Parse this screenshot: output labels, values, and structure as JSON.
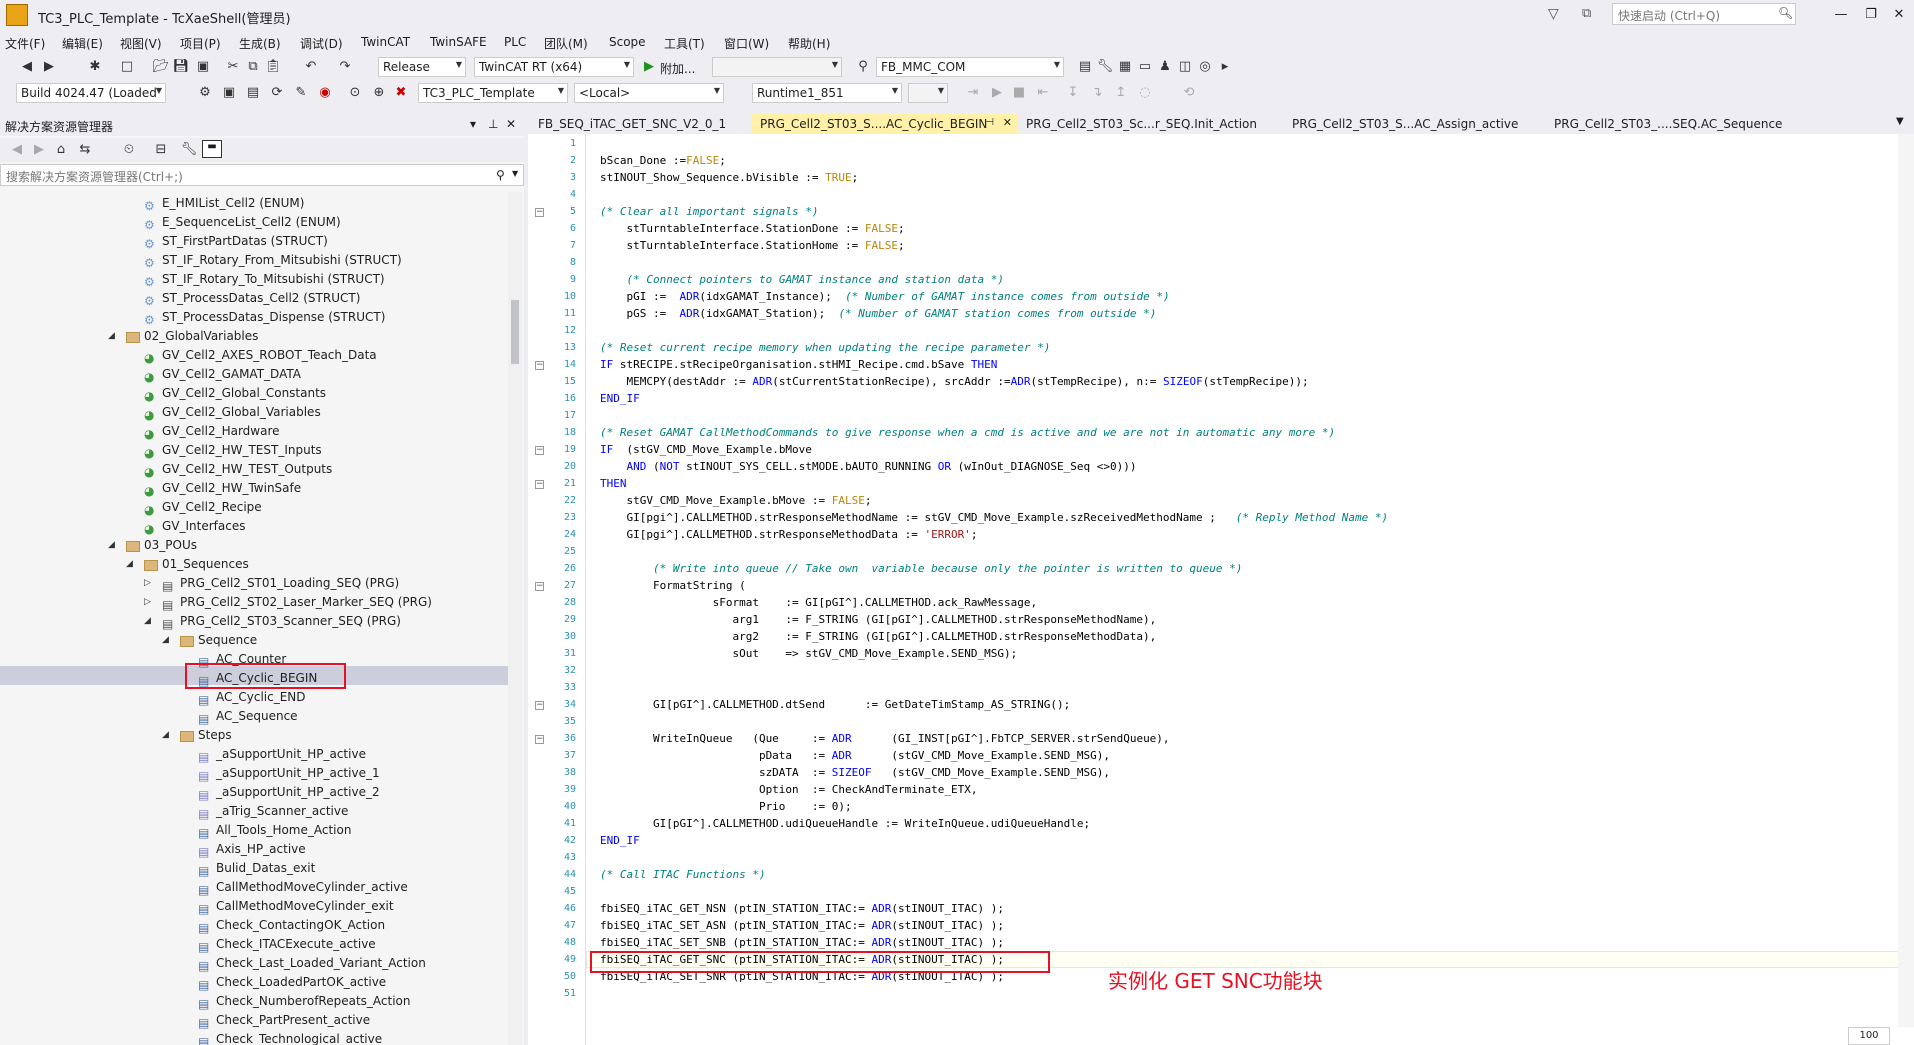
{
  "window": {
    "title": "TC3_PLC_Template - TcXaeShell(管理员)"
  },
  "quick_search": {
    "placeholder": "快速启动 (Ctrl+Q)"
  },
  "menu": [
    "文件(F)",
    "编辑(E)",
    "视图(V)",
    "项目(P)",
    "生成(B)",
    "调试(D)",
    "TwinCAT",
    "TwinSAFE",
    "PLC",
    "团队(M)",
    "Scope",
    "工具(T)",
    "窗口(W)",
    "帮助(H)"
  ],
  "toolbar": {
    "config": "Release",
    "platform": "TwinCAT RT (x64)",
    "attach": "附加...",
    "target_combo": "FB_MMC_COM",
    "build": "Build 4024.47 (Loaded",
    "project": "TC3_PLC_Template",
    "local": "<Local>",
    "runtime": "Runtime1_851"
  },
  "solution_explorer": {
    "title": "解决方案资源管理器",
    "search_placeholder": "搜索解决方案资源管理器(Ctrl+;)",
    "tree": [
      {
        "label": "E_HMIList_Cell2 (ENUM)",
        "level": 4,
        "type": "dut"
      },
      {
        "label": "E_SequenceList_Cell2 (ENUM)",
        "level": 4,
        "type": "dut"
      },
      {
        "label": "ST_FirstPartDatas (STRUCT)",
        "level": 4,
        "type": "dut"
      },
      {
        "label": "ST_IF_Rotary_From_Mitsubishi (STRUCT)",
        "level": 4,
        "type": "dut"
      },
      {
        "label": "ST_IF_Rotary_To_Mitsubishi (STRUCT)",
        "level": 4,
        "type": "dut"
      },
      {
        "label": "ST_ProcessDatas_Cell2 (STRUCT)",
        "level": 4,
        "type": "dut"
      },
      {
        "label": "ST_ProcessDatas_Dispense (STRUCT)",
        "level": 4,
        "type": "dut"
      },
      {
        "label": "02_GlobalVariables",
        "level": 3,
        "type": "folder",
        "exp": "open"
      },
      {
        "label": "GV_Cell2_AXES_ROBOT_Teach_Data",
        "level": 4,
        "type": "gvl"
      },
      {
        "label": "GV_Cell2_GAMAT_DATA",
        "level": 4,
        "type": "gvl"
      },
      {
        "label": "GV_Cell2_Global_Constants",
        "level": 4,
        "type": "gvl"
      },
      {
        "label": "GV_Cell2_Global_Variables",
        "level": 4,
        "type": "gvl"
      },
      {
        "label": "GV_Cell2_Hardware",
        "level": 4,
        "type": "gvl"
      },
      {
        "label": "GV_Cell2_HW_TEST_Inputs",
        "level": 4,
        "type": "gvl"
      },
      {
        "label": "GV_Cell2_HW_TEST_Outputs",
        "level": 4,
        "type": "gvl"
      },
      {
        "label": "GV_Cell2_HW_TwinSafe",
        "level": 4,
        "type": "gvl"
      },
      {
        "label": "GV_Cell2_Recipe",
        "level": 4,
        "type": "gvl"
      },
      {
        "label": "GV_Interfaces",
        "level": 4,
        "type": "gvl"
      },
      {
        "label": "03_POUs",
        "level": 3,
        "type": "folder",
        "exp": "open"
      },
      {
        "label": "01_Sequences",
        "level": 4,
        "type": "folder",
        "exp": "open"
      },
      {
        "label": "PRG_Cell2_ST01_Loading_SEQ (PRG)",
        "level": 5,
        "type": "pou",
        "exp": "closed"
      },
      {
        "label": "PRG_Cell2_ST02_Laser_Marker_SEQ (PRG)",
        "level": 5,
        "type": "pou",
        "exp": "closed"
      },
      {
        "label": "PRG_Cell2_ST03_Scanner_SEQ (PRG)",
        "level": 5,
        "type": "pou",
        "exp": "open"
      },
      {
        "label": "Sequence",
        "level": 6,
        "type": "folder",
        "exp": "open"
      },
      {
        "label": "AC_Counter",
        "level": 7,
        "type": "action"
      },
      {
        "label": "AC_Cyclic_BEGIN",
        "level": 7,
        "type": "action",
        "selected": true
      },
      {
        "label": "AC_Cyclic_END",
        "level": 7,
        "type": "action"
      },
      {
        "label": "AC_Sequence",
        "level": 7,
        "type": "action"
      },
      {
        "label": "Steps",
        "level": 6,
        "type": "folder",
        "exp": "open"
      },
      {
        "label": "_aSupportUnit_HP_active",
        "level": 7,
        "type": "trans"
      },
      {
        "label": "_aSupportUnit_HP_active_1",
        "level": 7,
        "type": "trans"
      },
      {
        "label": "_aSupportUnit_HP_active_2",
        "level": 7,
        "type": "trans"
      },
      {
        "label": "_aTrig_Scanner_active",
        "level": 7,
        "type": "trans"
      },
      {
        "label": "All_Tools_Home_Action",
        "level": 7,
        "type": "action"
      },
      {
        "label": "Axis_HP_active",
        "level": 7,
        "type": "trans"
      },
      {
        "label": "Bulid_Datas_exit",
        "level": 7,
        "type": "action"
      },
      {
        "label": "CallMethodMoveCylinder_active",
        "level": 7,
        "type": "action"
      },
      {
        "label": "CallMethodMoveCylinder_exit",
        "level": 7,
        "type": "action"
      },
      {
        "label": "Check_ContactingOK_Action",
        "level": 7,
        "type": "action"
      },
      {
        "label": "Check_ITACExecute_active",
        "level": 7,
        "type": "action"
      },
      {
        "label": "Check_Last_Loaded_Variant_Action",
        "level": 7,
        "type": "action"
      },
      {
        "label": "Check_LoadedPartOK_active",
        "level": 7,
        "type": "action"
      },
      {
        "label": "Check_NumberofRepeats_Action",
        "level": 7,
        "type": "action"
      },
      {
        "label": "Check_PartPresent_active",
        "level": 7,
        "type": "action"
      },
      {
        "label": "Check_Technological_active",
        "level": 7,
        "type": "action"
      }
    ]
  },
  "tabs": [
    {
      "label": "FB_SEQ_iTAC_GET_SNC_V2_0_1",
      "active": false
    },
    {
      "label": "PRG_Cell2_ST03_S....AC_Cyclic_BEGIN",
      "active": true
    },
    {
      "label": "PRG_Cell2_ST03_Sc...r_SEQ.Init_Action",
      "active": false
    },
    {
      "label": "PRG_Cell2_ST03_S...AC_Assign_active",
      "active": false
    },
    {
      "label": "PRG_Cell2_ST03_....SEQ.AC_Sequence",
      "active": false
    }
  ],
  "code_lines": [
    "",
    "bScan_Done :=FALSE;",
    "stINOUT_Show_Sequence.bVisible := TRUE;",
    "",
    "(* Clear all important signals *)",
    "    stTurntableInterface.StationDone := FALSE;",
    "    stTurntableInterface.StationHome := FALSE;",
    "",
    "    (* Connect pointers to GAMAT instance and station data *)",
    "    pGI :=  ADR(idxGAMAT_Instance);  (* Number of GAMAT instance comes from outside *)",
    "    pGS :=  ADR(idxGAMAT_Station);  (* Number of GAMAT station comes from outside *)",
    "",
    "(* Reset current recipe memory when updating the recipe parameter *)",
    "IF stRECIPE.stRecipeOrganisation.stHMI_Recipe.cmd.bSave THEN",
    "    MEMCPY(destAddr := ADR(stCurrentStationRecipe), srcAddr :=ADR(stTempRecipe), n:= SIZEOF(stTempRecipe));",
    "END_IF",
    "",
    "(* Reset GAMAT CallMethodCommands to give response when a cmd is active and we are not in automatic any more *)",
    "IF  (stGV_CMD_Move_Example.bMove",
    "    AND (NOT stINOUT_SYS_CELL.stMODE.bAUTO_RUNNING OR (wInOut_DIAGNOSE_Seq <>0)))",
    "THEN",
    "    stGV_CMD_Move_Example.bMove := FALSE;",
    "    GI[pgi^].CALLMETHOD.strResponseMethodName := stGV_CMD_Move_Example.szReceivedMethodName ;   (* Reply Method Name *)",
    "    GI[pgi^].CALLMETHOD.strResponseMethodData := 'ERROR';",
    "",
    "        (* Write into queue // Take own  variable because only the pointer is written to queue *)",
    "        FormatString (",
    "                 sFormat    := GI[pGI^].CALLMETHOD.ack_RawMessage,",
    "                    arg1    := F_STRING (GI[pGI^].CALLMETHOD.strResponseMethodName),",
    "                    arg2    := F_STRING (GI[pGI^].CALLMETHOD.strResponseMethodData),",
    "                    sOut    => stGV_CMD_Move_Example.SEND_MSG);",
    "",
    "",
    "        GI[pGI^].CALLMETHOD.dtSend      := GetDateTimStamp_AS_STRING();",
    "",
    "        WriteInQueue   (Que     := ADR      (GI_INST[pGI^].FbTCP_SERVER.strSendQueue),",
    "                        pData   := ADR      (stGV_CMD_Move_Example.SEND_MSG),",
    "                        szDATA  := SIZEOF   (stGV_CMD_Move_Example.SEND_MSG),",
    "                        Option  := CheckAndTerminate_ETX,",
    "                        Prio    := 0);",
    "        GI[pGI^].CALLMETHOD.udiQueueHandle := WriteInQueue.udiQueueHandle;",
    "END_IF",
    "",
    "(* Call ITAC Functions *)",
    "",
    "fbiSEQ_iTAC_GET_NSN (ptIN_STATION_ITAC:= ADR(stINOUT_ITAC) );",
    "fbiSEQ_iTAC_SET_ASN (ptIN_STATION_ITAC:= ADR(stINOUT_ITAC) );",
    "fbiSEQ_iTAC_SET_SNB (ptIN_STATION_ITAC:= ADR(stINOUT_ITAC) );",
    "fbiSEQ_iTAC_GET_SNC (ptIN_STATION_ITAC:= ADR(stINOUT_ITAC) );",
    "fbiSEQ_iTAC_SET_SNR (ptIN_STATION_ITAC:= ADR(stINOUT_ITAC) );",
    ""
  ],
  "annotation": "实例化 GET SNC功能块",
  "zoom": "100",
  "colors": {
    "keyword": "#0000ff",
    "comment": "#008080",
    "linenumber": "#2b91af",
    "annotation": "#e81123",
    "active_tab": "#fff1a8"
  }
}
